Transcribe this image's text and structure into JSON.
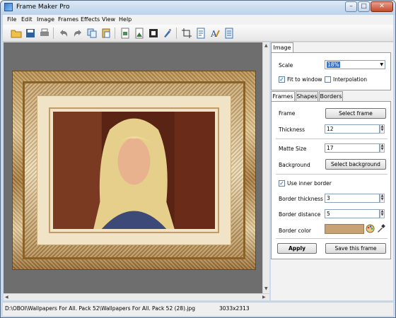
{
  "window": {
    "title": "Frame Maker Pro"
  },
  "menu": [
    "File",
    "Edit",
    "Image",
    "Frames",
    "Effects",
    "View",
    "Help"
  ],
  "image_tab": {
    "tab_label": "Image",
    "scale_label": "Scale",
    "scale_value": "18%",
    "fit_label": "Fit to window",
    "fit_checked": true,
    "interp_label": "Interpolation",
    "interp_checked": false
  },
  "frames_panel": {
    "tabs": [
      "Frames",
      "Shapes",
      "Borders"
    ],
    "frame_label": "Frame",
    "select_frame": "Select frame",
    "thickness_label": "Thickness",
    "thickness_value": "12",
    "matte_label": "Matte Size",
    "matte_value": "17",
    "background_label": "Background",
    "select_background": "Select background",
    "inner_border_label": "Use inner border",
    "inner_border_checked": true,
    "border_thickness_label": "Border thickness",
    "border_thickness_value": "3",
    "border_distance_label": "Border distance",
    "border_distance_value": "5",
    "border_color_label": "Border color",
    "border_color": "#c8a175",
    "apply": "Apply",
    "save_frame": "Save this frame"
  },
  "status": {
    "path": "D:\\OBOI\\Wallpapers For All. Pack 52\\Wallpapers For All. Pack 52 (28).jpg",
    "dims": "3033x2313"
  }
}
